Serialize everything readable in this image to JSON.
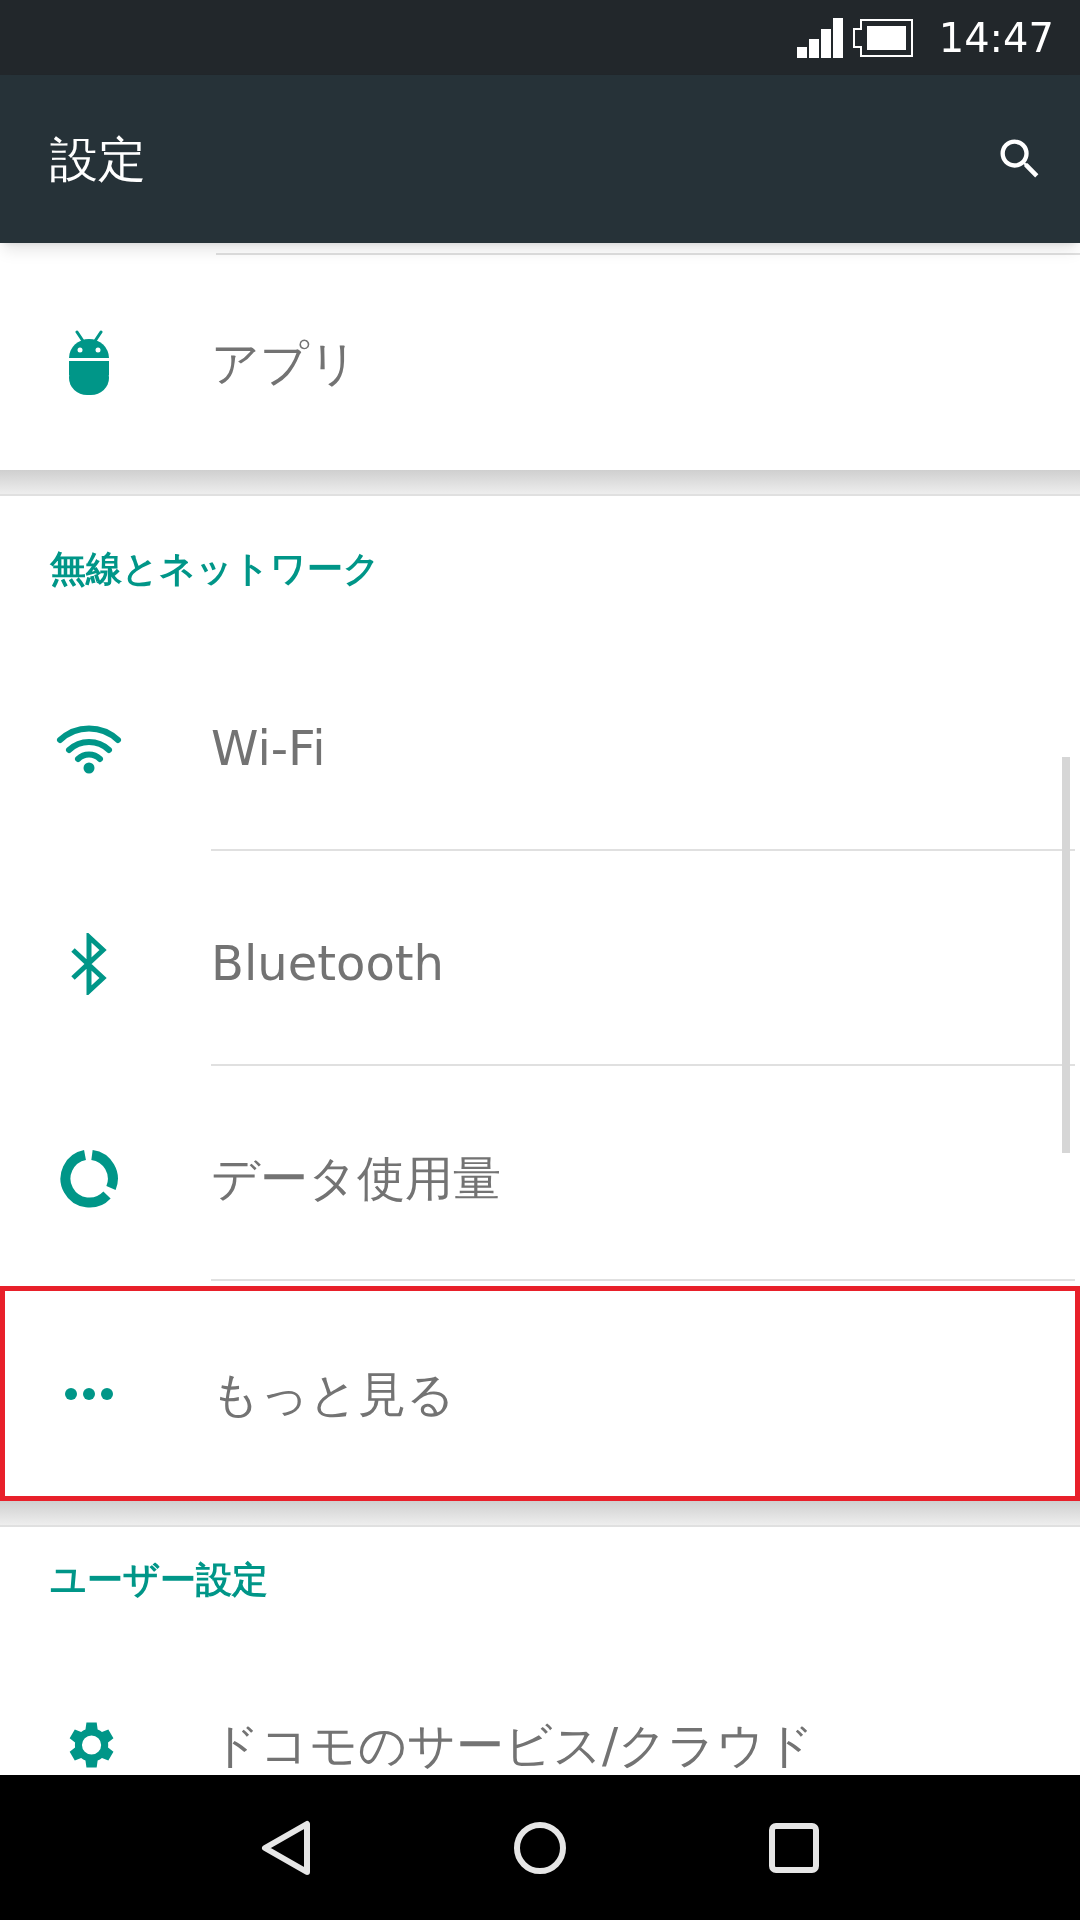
{
  "status_bar": {
    "time": "14:47"
  },
  "app_bar": {
    "title": "設定"
  },
  "sections": [
    {
      "items": [
        {
          "label": "アプリ",
          "highlighted": false
        }
      ]
    },
    {
      "header": "無線とネットワーク",
      "items": [
        {
          "label": "Wi-Fi",
          "highlighted": false
        },
        {
          "label": "Bluetooth",
          "highlighted": false
        },
        {
          "label": "データ使用量",
          "highlighted": false
        },
        {
          "label": "もっと見る",
          "highlighted": true
        }
      ]
    },
    {
      "header": "ユーザー設定",
      "items": [
        {
          "label": "ドコモのサービス/クラウド",
          "highlighted": false
        }
      ]
    }
  ]
}
